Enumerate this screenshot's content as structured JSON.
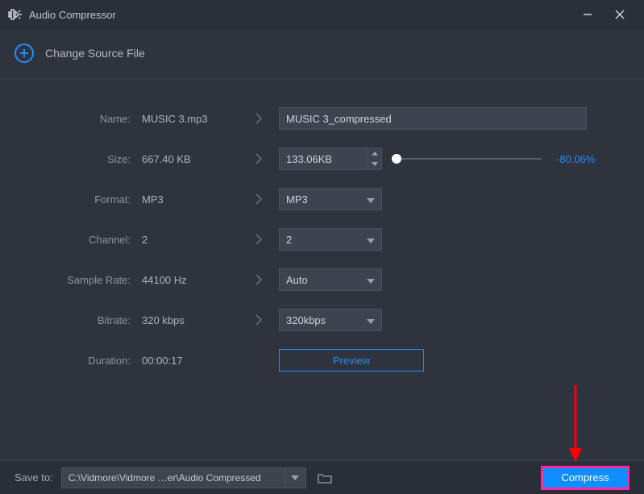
{
  "titlebar": {
    "title": "Audio Compressor"
  },
  "source": {
    "label": "Change Source File"
  },
  "rows": {
    "name": {
      "label": "Name:",
      "current": "MUSIC 3.mp3",
      "value": "MUSIC 3_compressed"
    },
    "size": {
      "label": "Size:",
      "current": "667.40 KB",
      "value": "133.06KB",
      "percent": "-80.06%"
    },
    "format": {
      "label": "Format:",
      "current": "MP3",
      "value": "MP3"
    },
    "channel": {
      "label": "Channel:",
      "current": "2",
      "value": "2"
    },
    "samplerate": {
      "label": "Sample Rate:",
      "current": "44100 Hz",
      "value": "Auto"
    },
    "bitrate": {
      "label": "Bitrate:",
      "current": "320 kbps",
      "value": "320kbps"
    },
    "duration": {
      "label": "Duration:",
      "current": "00:00:17"
    }
  },
  "preview": {
    "label": "Preview"
  },
  "bottom": {
    "save_label": "Save to:",
    "path": "C:\\Vidmore\\Vidmore …er\\Audio Compressed",
    "compress": "Compress"
  }
}
